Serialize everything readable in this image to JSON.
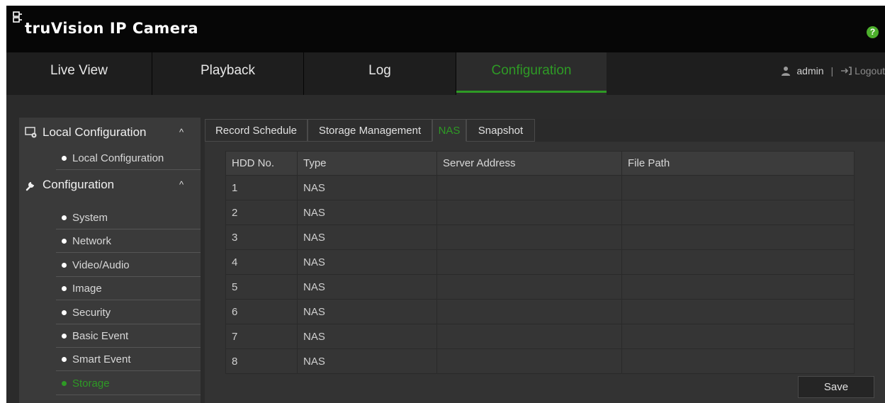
{
  "header": {
    "brand": "truVision IP Camera",
    "help_label": "?"
  },
  "nav": {
    "tabs": [
      "Live View",
      "Playback",
      "Log",
      "Configuration"
    ],
    "active_tab": "Configuration",
    "user": "admin",
    "separator": "|",
    "logout": "Logout"
  },
  "sidebar": {
    "sections": [
      {
        "label": "Local Configuration",
        "icon": "local-config-icon",
        "chevron": "^",
        "items": [
          "Local Configuration"
        ]
      },
      {
        "label": "Configuration",
        "icon": "wrench-icon",
        "chevron": "^",
        "items": [
          "System",
          "Network",
          "Video/Audio",
          "Image",
          "Security",
          "Basic Event",
          "Smart Event",
          "Storage"
        ]
      }
    ],
    "active_item": "Storage"
  },
  "subtabs": [
    "Record Schedule",
    "Storage Management",
    "NAS",
    "Snapshot"
  ],
  "active_subtab": "NAS",
  "table": {
    "columns": [
      "HDD No.",
      "Type",
      "Server Address",
      "File Path"
    ],
    "rows": [
      [
        "1",
        "NAS",
        "",
        ""
      ],
      [
        "2",
        "NAS",
        "",
        ""
      ],
      [
        "3",
        "NAS",
        "",
        ""
      ],
      [
        "4",
        "NAS",
        "",
        ""
      ],
      [
        "5",
        "NAS",
        "",
        ""
      ],
      [
        "6",
        "NAS",
        "",
        ""
      ],
      [
        "7",
        "NAS",
        "",
        ""
      ],
      [
        "8",
        "NAS",
        "",
        ""
      ]
    ]
  },
  "save_label": "Save",
  "colors": {
    "accent": "#2e9a25",
    "background": "#2b2b2b",
    "header": "#060606"
  }
}
